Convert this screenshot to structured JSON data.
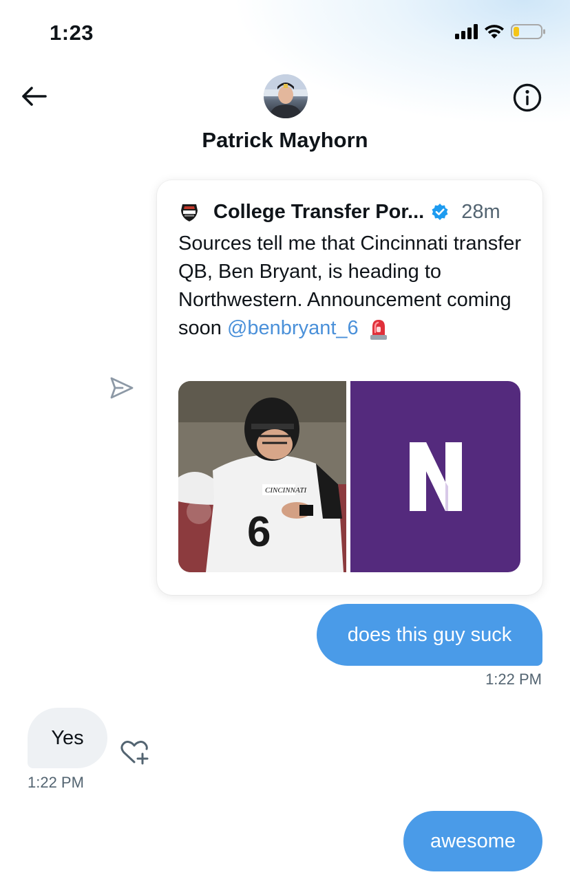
{
  "status_bar": {
    "time": "1:23"
  },
  "header": {
    "contact_name": "Patrick Mayhorn"
  },
  "tweet": {
    "author": "College Transfer Por...",
    "time": "28m",
    "text": "Sources tell me that Cincinnati transfer QB, Ben Bryant, is heading to Northwestern. Announcement coming soon",
    "mention": "@benbryant_6",
    "photo_left": {
      "jersey_text": "CINCINNATI",
      "jersey_number": "6"
    },
    "photo_right": {
      "logo_letter": "N"
    }
  },
  "messages": [
    {
      "text": "does this guy suck",
      "time": "1:22 PM",
      "direction": "sent"
    },
    {
      "text": "Yes",
      "time": "1:22 PM",
      "direction": "received"
    },
    {
      "text": "awesome",
      "direction": "sent"
    }
  ],
  "colors": {
    "sent_bubble": "#4a9be8",
    "received_bubble": "#eef1f4",
    "mention": "#4a90d9",
    "verified": "#1d9bf0",
    "northwestern_purple": "#542a7d"
  },
  "icons": {
    "back": "arrow-left-icon",
    "info": "info-icon",
    "share": "send-icon",
    "react": "heart-plus-icon",
    "verified": "verified-badge-icon",
    "siren": "siren-icon"
  }
}
